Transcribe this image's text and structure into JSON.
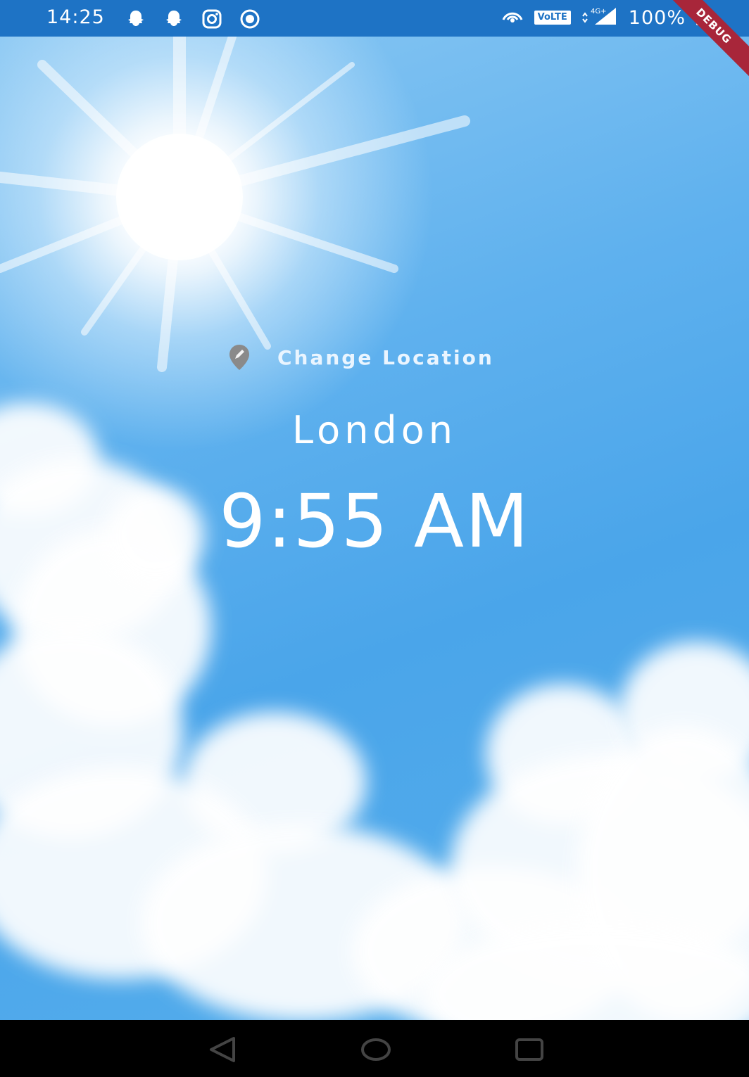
{
  "status_bar": {
    "time": "14:25",
    "left_icons": [
      "snapchat-icon",
      "snapchat-icon",
      "instagram-icon",
      "record-icon"
    ],
    "volte": "VoLTE",
    "network": "4G+",
    "battery": "100%"
  },
  "debug_banner": "DEBUG",
  "location": {
    "change_label": "Change Location",
    "city": "London",
    "time": "9:55 AM"
  },
  "colors": {
    "status_bar": "#1e73c5",
    "sky": "#4aa6ea",
    "text": "#ffffff",
    "icon_grey": "#8a8a8a",
    "debug": "#a8263a"
  }
}
